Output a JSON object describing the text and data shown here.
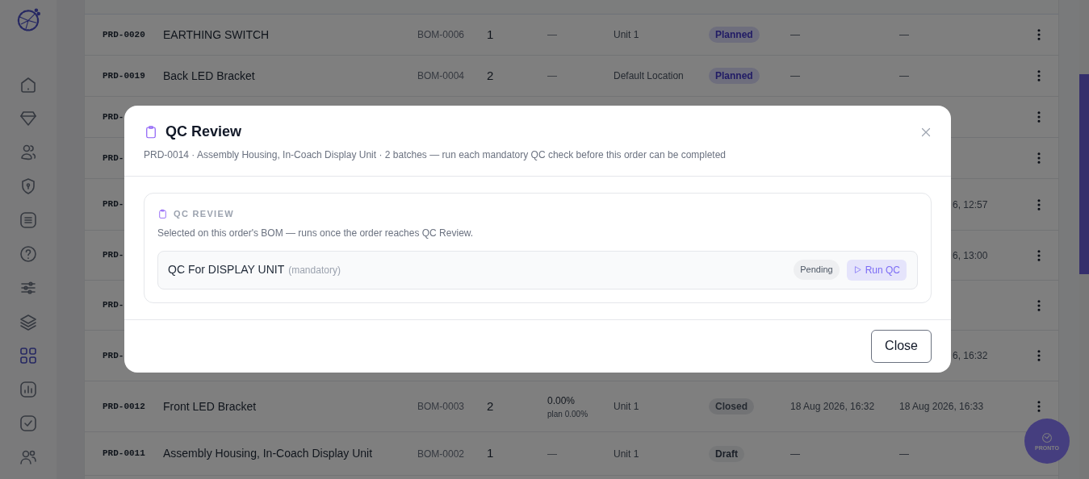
{
  "sidebar": {
    "items": [
      {
        "selected": false
      },
      {
        "selected": false
      },
      {
        "selected": false
      },
      {
        "selected": false
      },
      {
        "selected": false
      },
      {
        "selected": false
      },
      {
        "selected": false
      },
      {
        "selected": false
      },
      {
        "selected": true
      },
      {
        "selected": false
      },
      {
        "selected": false
      },
      {
        "selected": false
      }
    ]
  },
  "table": {
    "rows": [
      {
        "kind": "full",
        "id": "PRD-0020",
        "name": "EARTHING SWITCH",
        "bom": "BOM-0006",
        "qty": "1",
        "yield": "—",
        "location": "Unit 1",
        "status": {
          "text": "Planned",
          "kind": "planned"
        },
        "started": "—",
        "finished": "—"
      },
      {
        "kind": "full",
        "id": "PRD-0019",
        "name": "Back LED Bracket",
        "bom": "BOM-0004",
        "qty": "2",
        "yield": "—",
        "location": "Default Location",
        "status": {
          "text": "Planned",
          "kind": "planned"
        },
        "started": "—",
        "finished": "—"
      },
      {
        "kind": "covered",
        "id": "PRD-"
      },
      {
        "kind": "covered",
        "id": "PRD-"
      },
      {
        "kind": "covered",
        "id": "PRD-",
        "finished": "6, 12:57"
      },
      {
        "kind": "covered",
        "id": "PRD-",
        "finished": "6, 13:00"
      },
      {
        "kind": "covered",
        "id": "PRD-"
      },
      {
        "kind": "covered",
        "id": "PRD-",
        "finished": "6, 16:32"
      },
      {
        "kind": "full",
        "id": "PRD-0012",
        "name": "Front LED Bracket",
        "bom": "BOM-0003",
        "qty": "2",
        "yield": "0.00%",
        "yield_note": "plan 0.00%",
        "location": "Unit 1",
        "status": {
          "text": "Closed",
          "kind": "closed"
        },
        "started": "18 Aug 2026, 16:32",
        "finished": "18 Aug 2026, 16:33"
      },
      {
        "kind": "full",
        "id": "PRD-0011",
        "name": "Assembly Housing, In-Coach Display Unit",
        "bom": "BOM-0002",
        "qty": "1",
        "yield": "—",
        "location": "Unit 1",
        "status": {
          "text": "Draft",
          "kind": "draft"
        },
        "started": "—",
        "finished": "—"
      }
    ]
  },
  "fab": {
    "label": "PRONTO"
  },
  "modal": {
    "title": "QC Review",
    "subtitle": "PRD-0014 · Assembly Housing, In-Coach Display Unit · 2 batches — run each mandatory QC check before this order can be completed",
    "section": {
      "heading": "QC REVIEW",
      "description": "Selected on this order's BOM — runs once the order reaches QC Review.",
      "checks": [
        {
          "name": "QC For DISPLAY UNIT",
          "note": "(mandatory)",
          "status": "Pending",
          "action": "Run QC"
        }
      ]
    },
    "close_button": "Close"
  }
}
